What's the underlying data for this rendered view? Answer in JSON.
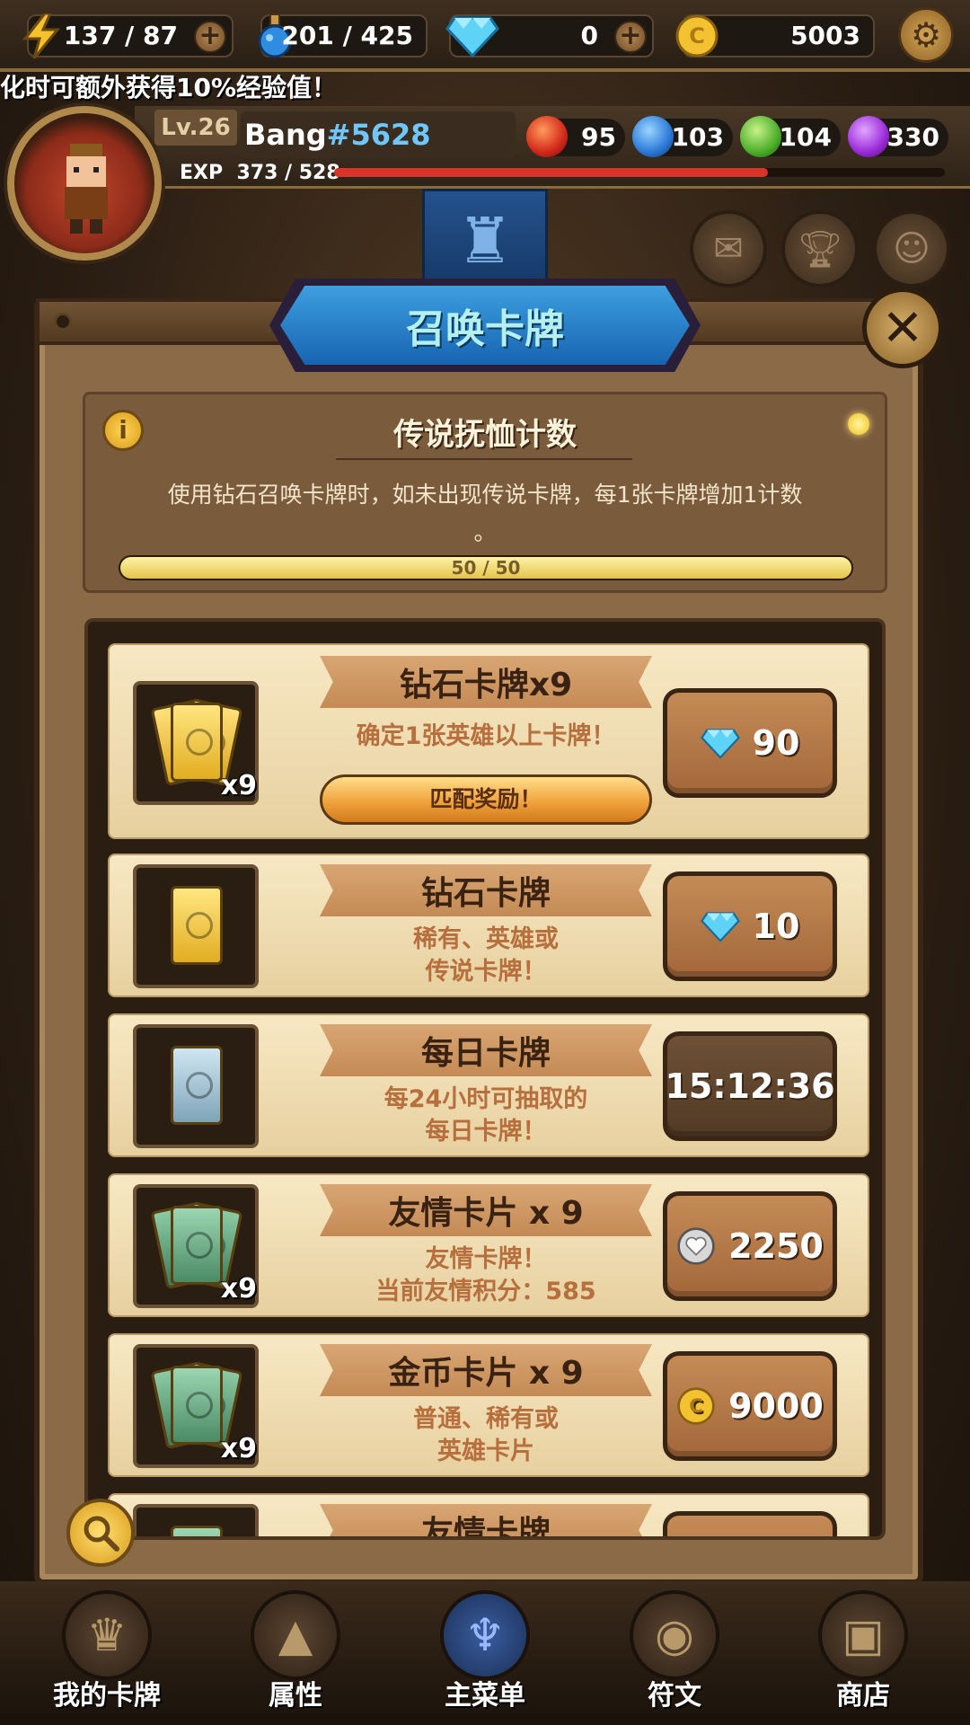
{
  "resources": {
    "energy": "137 / 87",
    "potion": "201 / 425",
    "diamond": "0",
    "gold": "5003"
  },
  "ticker": "化时可额外获得10%经验值！",
  "profile": {
    "level": "Lv.26",
    "name": "Bang",
    "tag": "#5628",
    "exp_label": "EXP",
    "exp_value": "373 / 528",
    "exp_fraction": 0.71,
    "elements": {
      "fire": "95",
      "water": "103",
      "nature": "104",
      "dark": "330"
    }
  },
  "modal": {
    "title": "召唤卡牌",
    "pity": {
      "title": "传说抚恤计数",
      "desc_line1": "使用钻石召唤卡牌时，如未出现传说卡牌，每1张卡牌增加1计数",
      "desc_line2": "。",
      "progress_label": "50 / 50",
      "progress_fraction": 1.0
    },
    "rows": [
      {
        "title": "钻石卡牌x9",
        "desc": "确定1张英雄以上卡牌！",
        "badge": "x9",
        "bonus": "匹配奖励！",
        "cost_icon": "diamond-icon",
        "cost": "90"
      },
      {
        "title": "钻石卡牌",
        "desc1": "稀有、英雄或",
        "desc2": "传说卡牌！",
        "cost_icon": "diamond-icon",
        "cost": "10"
      },
      {
        "title": "每日卡牌",
        "desc1": "每24小时可抽取的",
        "desc2": "每日卡牌！",
        "cost": "15:12:36"
      },
      {
        "title": "友情卡片 x 9",
        "desc1": "友情卡牌！",
        "desc2": "当前友情积分：585",
        "badge": "x9",
        "cost_icon": "friendship-coin-icon",
        "cost": "2250"
      },
      {
        "title": "金币卡片 x 9",
        "desc1": "普通、稀有或",
        "desc2": "英雄卡片",
        "badge": "x9",
        "cost_icon": "gold-coin-icon",
        "cost": "9000"
      },
      {
        "title": "友情卡牌"
      }
    ]
  },
  "nav": [
    "我的卡牌",
    "属性",
    "主菜单",
    "符文",
    "商店"
  ],
  "colors": {
    "diamond": "#5fd3f5",
    "gold": "#f2c231",
    "banner_blue": "#2a82cf",
    "exp_red": "#d8342a"
  }
}
